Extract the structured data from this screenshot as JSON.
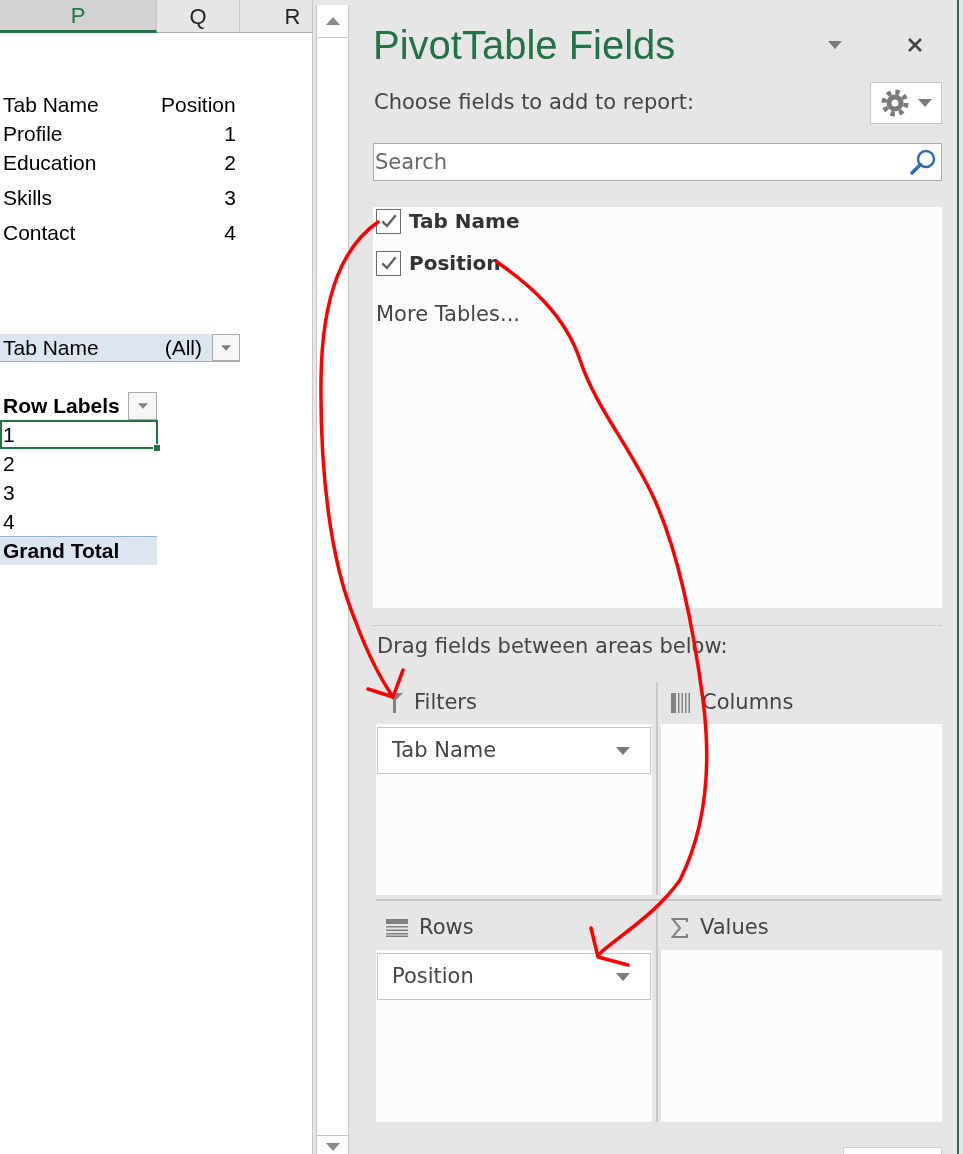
{
  "sheet": {
    "columns": [
      {
        "label": "P",
        "selected": true
      },
      {
        "label": "Q",
        "selected": false
      },
      {
        "label": "R",
        "selected": false
      }
    ],
    "table": {
      "columns": [
        "Tab Name",
        "Position"
      ],
      "rows": [
        [
          "Profile",
          "1"
        ],
        [
          "Education",
          "2"
        ],
        [
          "Skills",
          "3"
        ],
        [
          "Contact",
          "4"
        ]
      ]
    },
    "pivot": {
      "filter": {
        "field": "Tab Name",
        "value": "(All)"
      },
      "row_header": "Row Labels",
      "rows": [
        {
          "label": "1",
          "selected": true
        },
        {
          "label": "2",
          "selected": false
        },
        {
          "label": "3",
          "selected": false
        },
        {
          "label": "4",
          "selected": false
        }
      ],
      "total": "Grand Total"
    }
  },
  "panel": {
    "title": "PivotTable Fields",
    "prompt": "Choose fields to add to report:",
    "search": {
      "placeholder": "Search"
    },
    "fields": [
      {
        "label": "Tab Name",
        "checked": true
      },
      {
        "label": "Position",
        "checked": true
      }
    ],
    "more_tables": "More Tables...",
    "areas_prompt": "Drag fields between areas below:",
    "areas": [
      {
        "kind": "filters",
        "label": "Filters",
        "fields": [
          "Tab Name"
        ]
      },
      {
        "kind": "columns",
        "label": "Columns"
      },
      {
        "kind": "rows",
        "label": "Rows",
        "fields": [
          "Position"
        ]
      },
      {
        "kind": "values",
        "label": "Values"
      }
    ]
  }
}
